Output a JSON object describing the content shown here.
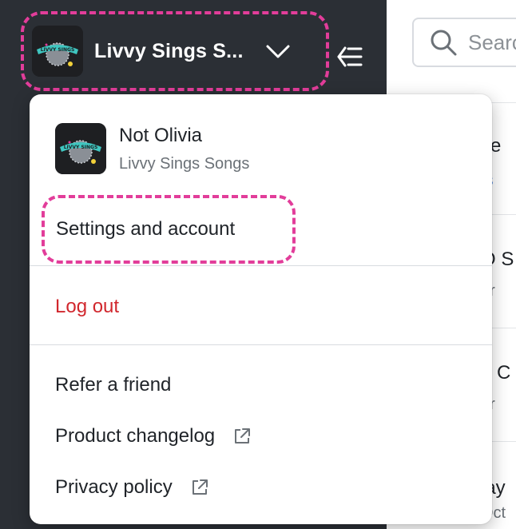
{
  "sidebar": {
    "workspace_name": "Livvy Sings S...",
    "logo_text": "LIVVY SINGS SONGS"
  },
  "search": {
    "placeholder": "Search"
  },
  "list": {
    "rows": [
      {
        "title": "se",
        "subtitle": "ts",
        "subtitle_is_link": true
      },
      {
        "title": "O S",
        "subtitle": "pr"
      },
      {
        "title": "n C",
        "subtitle": "pr"
      },
      {
        "title": "lay",
        "subtitle": "Oct"
      }
    ]
  },
  "menu": {
    "user_name": "Not Olivia",
    "workspace_name": "Livvy Sings Songs",
    "settings_label": "Settings and account",
    "logout_label": "Log out",
    "refer_label": "Refer a friend",
    "changelog_label": "Product changelog",
    "privacy_label": "Privacy policy"
  },
  "colors": {
    "sidebar_bg": "#2b2f35",
    "highlight": "#e23d9a",
    "danger": "#d1272d",
    "link": "#2f6fd6"
  },
  "icons": {
    "chevron": "chevron-down-icon",
    "collapse": "collapse-sidebar-icon",
    "search": "search-icon",
    "external": "external-link-icon"
  }
}
